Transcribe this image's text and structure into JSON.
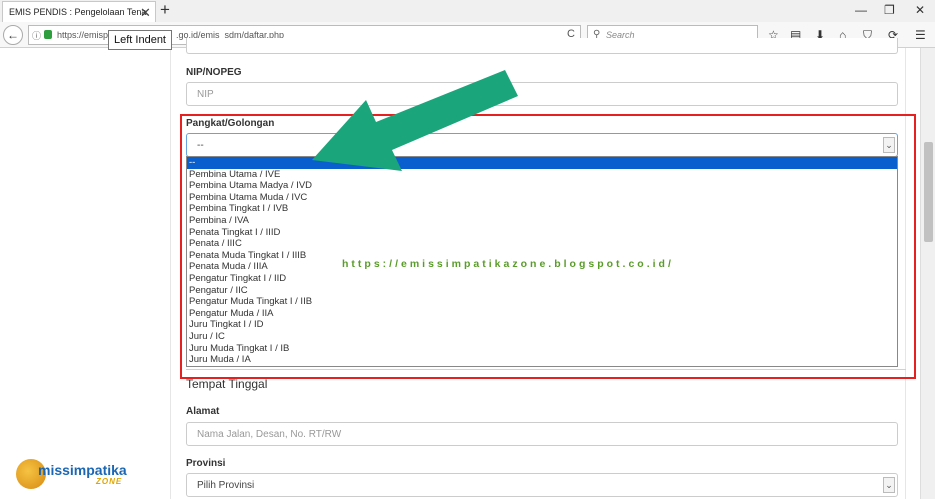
{
  "browser": {
    "tab_title": "EMIS PENDIS : Pengelolaan Tena",
    "tab_close": "✕",
    "new_tab": "+",
    "win_min": "—",
    "win_max": "❐",
    "win_close": "✕",
    "back_glyph": "←",
    "info_glyph": "ⓘ",
    "url_prefix": "https://emisp",
    "url_suffix": ".go.id/emis_sdm/daftar.php",
    "reload_glyph": "C",
    "search_placeholder": "Search",
    "search_glyph": "⚲",
    "tooltip": "Left Indent",
    "toolbar_icons": {
      "star": "☆",
      "reader": "▤",
      "download": "⬇",
      "home": "⌂",
      "pocket": "⛉",
      "sync": "⟳",
      "menu": "☰"
    }
  },
  "form": {
    "nip_label": "NIP/NOPEG",
    "nip_placeholder": "NIP",
    "pangkat_label": "Pangkat/Golongan",
    "pangkat_value": "--",
    "caret": "⌄",
    "pangkat_options": [
      "--",
      "Pembina Utama / IVE",
      "Pembina Utama Madya / IVD",
      "Pembina Utama Muda / IVC",
      "Pembina Tingkat I / IVB",
      "Pembina / IVA",
      "Penata Tingkat I / IIID",
      "Penata / IIIC",
      "Penata Muda Tingkat I / IIIB",
      "Penata Muda / IIIA",
      "Pengatur Tingkat I / IID",
      "Pengatur / IIC",
      "Pengatur Muda Tingkat I / IIB",
      "Pengatur Muda / IIA",
      "Juru Tingkat I / ID",
      "Juru / IC",
      "Juru Muda Tingkat I / IB",
      "Juru Muda / IA"
    ],
    "section_title": "Tempat Tinggal",
    "alamat_label": "Alamat",
    "alamat_placeholder": "Nama Jalan, Desan, No. RT/RW",
    "provinsi_label": "Provinsi",
    "provinsi_value": "Pilih Provinsi"
  },
  "watermark": "https://emissimpatikazone.blogspot.co.id/",
  "logo": {
    "main": "missimpatika",
    "sub": "ZONE"
  },
  "colors": {
    "highlight": "#e52020",
    "arrow": "#1aa57a",
    "selected": "#0a5fce"
  }
}
